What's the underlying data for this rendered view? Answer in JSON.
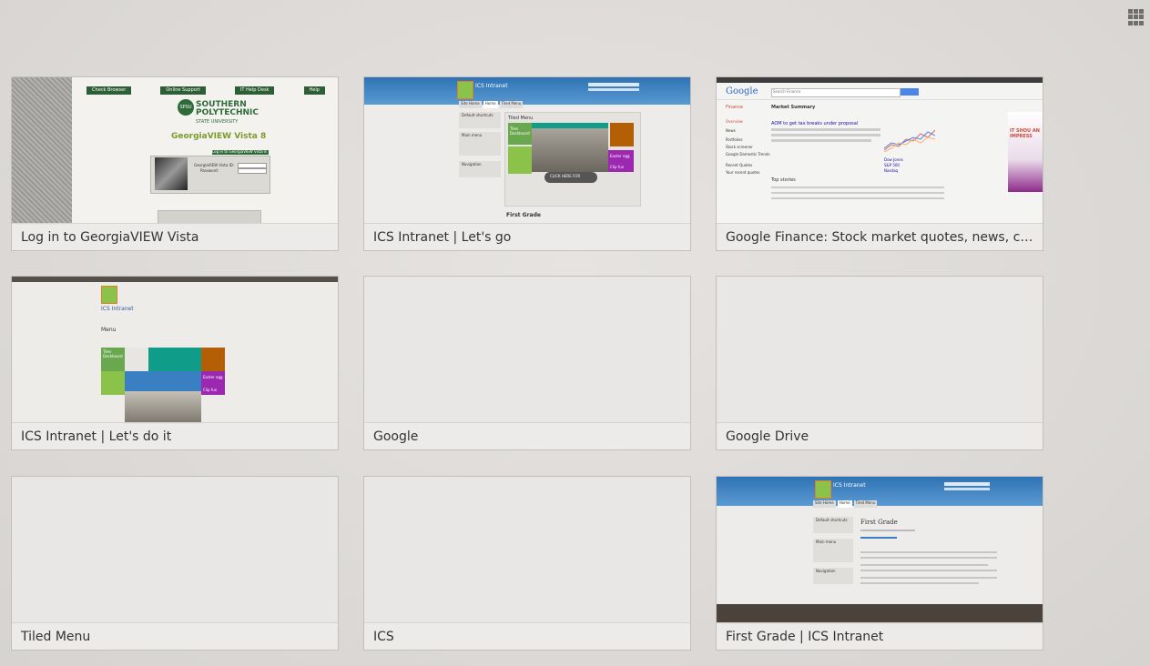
{
  "tiles": [
    {
      "title": "Log in to GeorgiaVIEW Vista"
    },
    {
      "title": "ICS Intranet | Let's go"
    },
    {
      "title": "Google Finance: Stock market quotes, news, curre..."
    },
    {
      "title": "ICS Intranet | Let's do it"
    },
    {
      "title": "Google"
    },
    {
      "title": "Google Drive"
    },
    {
      "title": "Tiled Menu"
    },
    {
      "title": "ICS"
    },
    {
      "title": "First Grade | ICS Intranet"
    }
  ],
  "thumbs": {
    "georgia": {
      "nav": [
        "Check Browser",
        "Online Support",
        "IT Help Desk",
        "Help"
      ],
      "brand": "SOUTHERN POLYTECHNIC",
      "brand_sub": "STATE UNIVERSITY",
      "logo": "SPSU",
      "heading": "GeorgiaVIEW Vista 8",
      "login_label": "GeorgiaVIEW Vista ID:",
      "password_label": "Password:",
      "login_btn": "Log in to GeorgiaVIEW Vista 8"
    },
    "ics": {
      "site": "ICS Intranet",
      "tabs": [
        "Site Home",
        "Home",
        "Tiled Menu"
      ],
      "menu_title": "Tiled Menu",
      "tile_dashboard": "Tiles Dashboard",
      "tile_easter": "Easter egg",
      "tile_clip": "Clip fun",
      "click_here": "CLICK HERE FOR",
      "footer_heading": "First Grade",
      "sidebar": [
        "Default shortcuts",
        "Main menu",
        "Navigation"
      ]
    },
    "finance": {
      "logo": "Google",
      "section": "Finance",
      "search": "Search Finance",
      "heading": "Market Summary",
      "headline": "AOM to get tax breaks under proposal",
      "top_stories": "Top stories",
      "ad_text": "IT SHOU AN IMPRESS",
      "left_nav": [
        "Overview",
        "News",
        "Portfolios",
        "Stock screener",
        "Google Domestic Trends",
        "Recent Quotes",
        "Your recent quotes"
      ],
      "indices": [
        "Dow Jones",
        "S&P 500",
        "Nasdaq"
      ]
    },
    "icsDo": {
      "site": "ICS Intranet",
      "menu": "Menu",
      "tile_dashboard": "Tiles Dashboard",
      "tile_easter": "Easter egg",
      "tile_clip": "Clip fun"
    },
    "firstGrade": {
      "site": "ICS Intranet",
      "tabs": [
        "Site Home",
        "Home",
        "Tiled Menu"
      ],
      "heading": "First Grade",
      "sidebar": [
        "Default shortcuts",
        "Main menu",
        "Navigation"
      ]
    }
  },
  "colors": {
    "ics_blue": "#3a7fc1",
    "spsu_green": "#2e6b3a",
    "finance_dark": "#3d3d3d",
    "tile_green": "#6aa84f",
    "tile_orange": "#b45f06",
    "tile_purple": "#9c27b0",
    "tile_teal": "#0f9d8a"
  }
}
